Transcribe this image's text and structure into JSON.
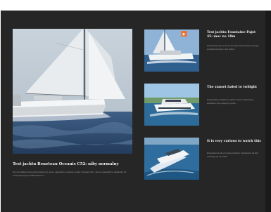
{
  "main": {
    "title": "Test jachtu Beneteau Oceanis C52: niby normalny",
    "excerpt": "Nie ma zaskoczenia, jeśli popatrzymy na ten najnowszy i większy model, Oceanis C52 - ale nie sprawdzimy dokładnie niż nowa propozycja od Beneteau to ..."
  },
  "cards": [
    {
      "title": "Test jachtu Fountaine Pajot 45: moc na 18m",
      "excerpt": "Rozpoczęcie pracy w stoczni Fountaine Pajot zawsze przyciąga przyjaciół portowych, żeby dobrze."
    },
    {
      "title": "The sunset faded to twilight",
      "excerpt": "Przepłynęliśmy kawałek tym jachtem zanim zaszło słońce. Wrażenia z rejsu opisujemy poniżej."
    },
    {
      "title": "It is very curious to watch this",
      "excerpt": "Motorówka tnie fale przy dużej prędkości. Sprawdzamy jak łódź zachowuje się na wodzie."
    }
  ],
  "colors": {
    "background": "#262626",
    "title": "#f2f2f2",
    "excerpt": "#9e9e9e",
    "badge": "#e8743b"
  }
}
